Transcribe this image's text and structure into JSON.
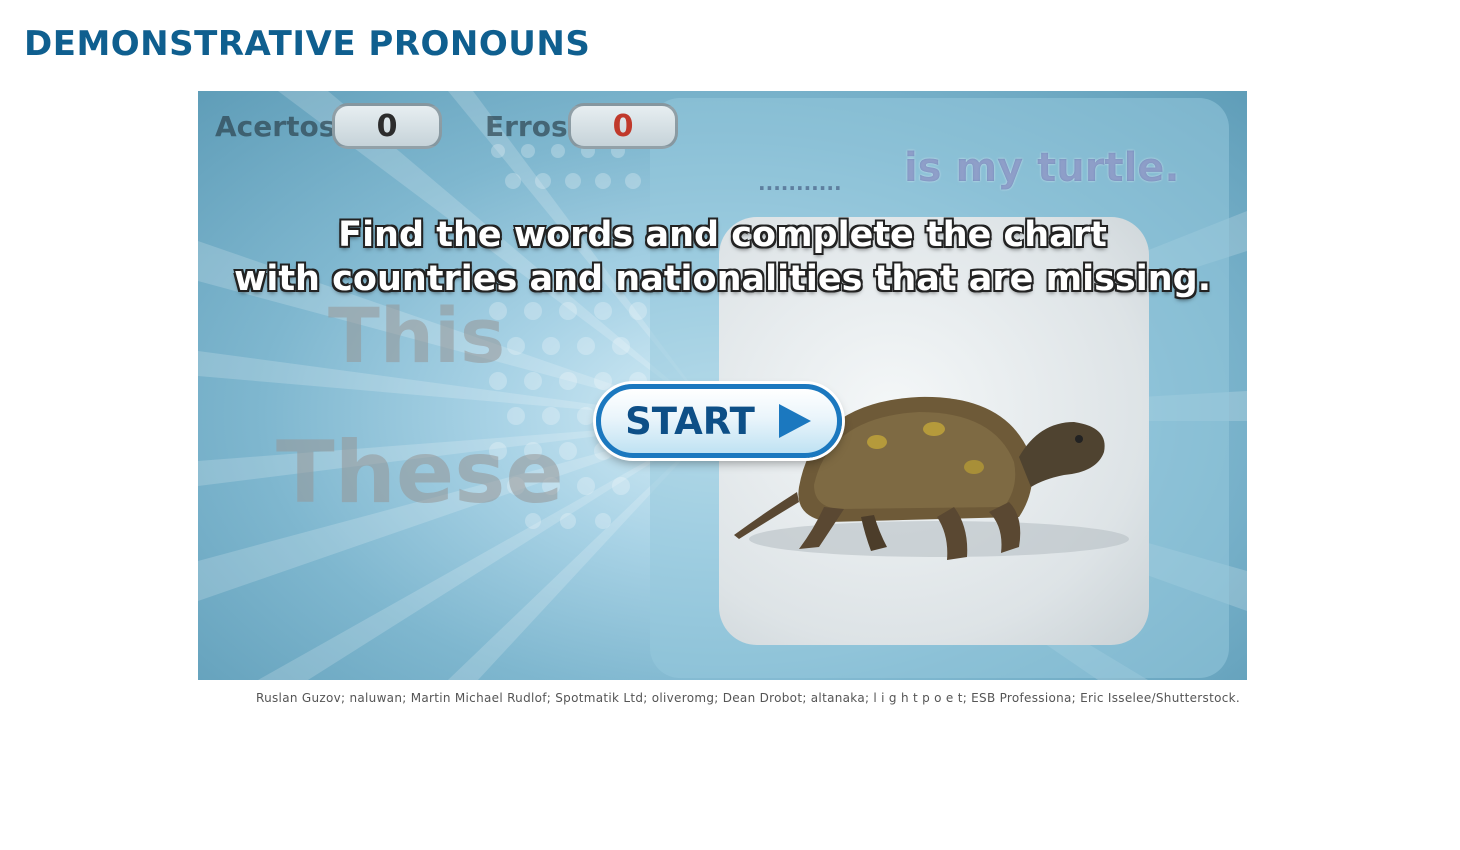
{
  "page": {
    "title": "DEMONSTRATIVE PRONOUNS"
  },
  "game": {
    "score": {
      "correct_label": "Acertos",
      "correct_value": "0",
      "errors_label": "Erros",
      "errors_value": "0"
    },
    "question": {
      "blank": "...........",
      "sentence": "is my turtle."
    },
    "options": [
      "This",
      "These"
    ],
    "instruction_line1": "Find the words and complete the chart",
    "instruction_line2": "with countries and nationalities that are missing.",
    "start_label": "START",
    "colors": {
      "title": "#0f5f8f",
      "start_border": "#1b78bf",
      "start_text": "#0d4f87",
      "errors_value": "#c0392b",
      "correct_value": "#2c2c2c"
    }
  },
  "credits": "Ruslan Guzov; naluwan; Martin Michael Rudlof; Spotmatik Ltd; oliveromg; Dean Drobot; altanaka; l i g h t p o e t; ESB Professiona; Eric Isselee/Shutterstock."
}
